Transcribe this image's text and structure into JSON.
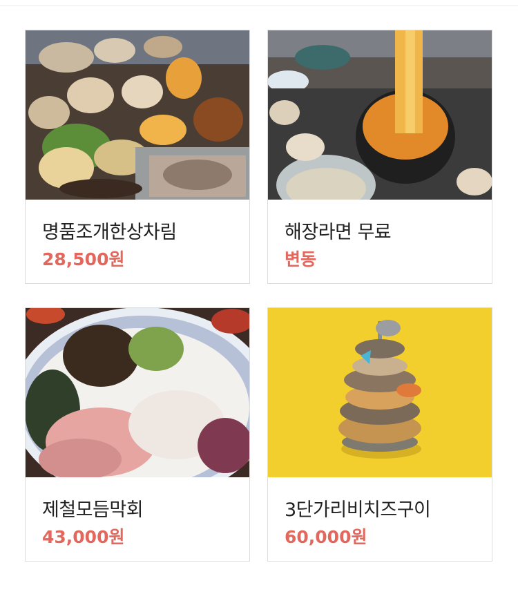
{
  "menu": {
    "items": [
      {
        "name": "명품조개한상차림",
        "price": "28,500원",
        "photo": "grilled-shellfish-platter-photo"
      },
      {
        "name": "해장라면 무료",
        "price": "변동",
        "photo": "ramen-noodles-photo"
      },
      {
        "name": "제철모듬막회",
        "price": "43,000원",
        "photo": "raw-fish-platter-photo"
      },
      {
        "name": "3단가리비치즈구이",
        "price": "60,000원",
        "photo": "scallop-tower-photo"
      }
    ]
  },
  "colors": {
    "price": "#e2675d",
    "title": "#222222",
    "card_border": "#dcdcdc",
    "tower_background": "#f3cf2e"
  }
}
